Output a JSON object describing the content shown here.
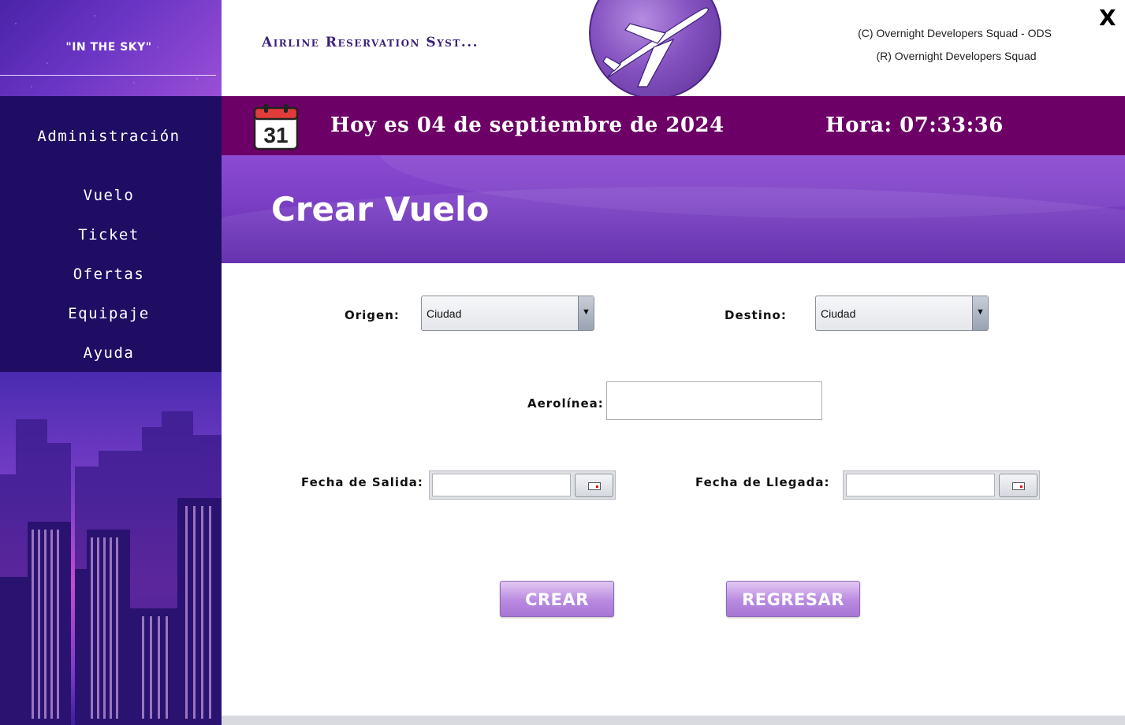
{
  "sidebar": {
    "brand": "\"IN THE SKY\"",
    "menu": [
      {
        "label": "Administración"
      },
      {
        "label": "Vuelo"
      },
      {
        "label": "Ticket"
      },
      {
        "label": "Ofertas"
      },
      {
        "label": "Equipaje"
      },
      {
        "label": "Ayuda"
      }
    ]
  },
  "header": {
    "app_title": "Airline Reservation Syst...",
    "copyright_line1": "(C) Overnight Developers Squad - ODS",
    "copyright_line2": "(R) Overnight Developers Squad",
    "close_label": "X"
  },
  "date_bar": {
    "calendar_day": "31",
    "date_text": "Hoy es 04 de septiembre de 2024",
    "time_text": "Hora: 07:33:36"
  },
  "page": {
    "title": "Crear Vuelo"
  },
  "form": {
    "origin_label": "Origen:",
    "origin_value": "Ciudad",
    "destination_label": "Destino:",
    "destination_value": "Ciudad",
    "airline_label": "Aerolínea:",
    "airline_value": "",
    "departure_label": "Fecha de Salida:",
    "departure_value": "",
    "arrival_label": "Fecha de Llegada:",
    "arrival_value": "",
    "create_button": "CREAR",
    "back_button": "REGRESAR"
  },
  "colors": {
    "sidebar_bg": "#1e0d63",
    "date_bar_bg": "#6c0066",
    "banner_bg": "#7a3ec4",
    "button_bg": "#b98ae0"
  },
  "icons": [
    "calendar-icon",
    "airplane-logo-icon",
    "close-icon",
    "dropdown-arrow-icon",
    "date-picker-icon"
  ]
}
